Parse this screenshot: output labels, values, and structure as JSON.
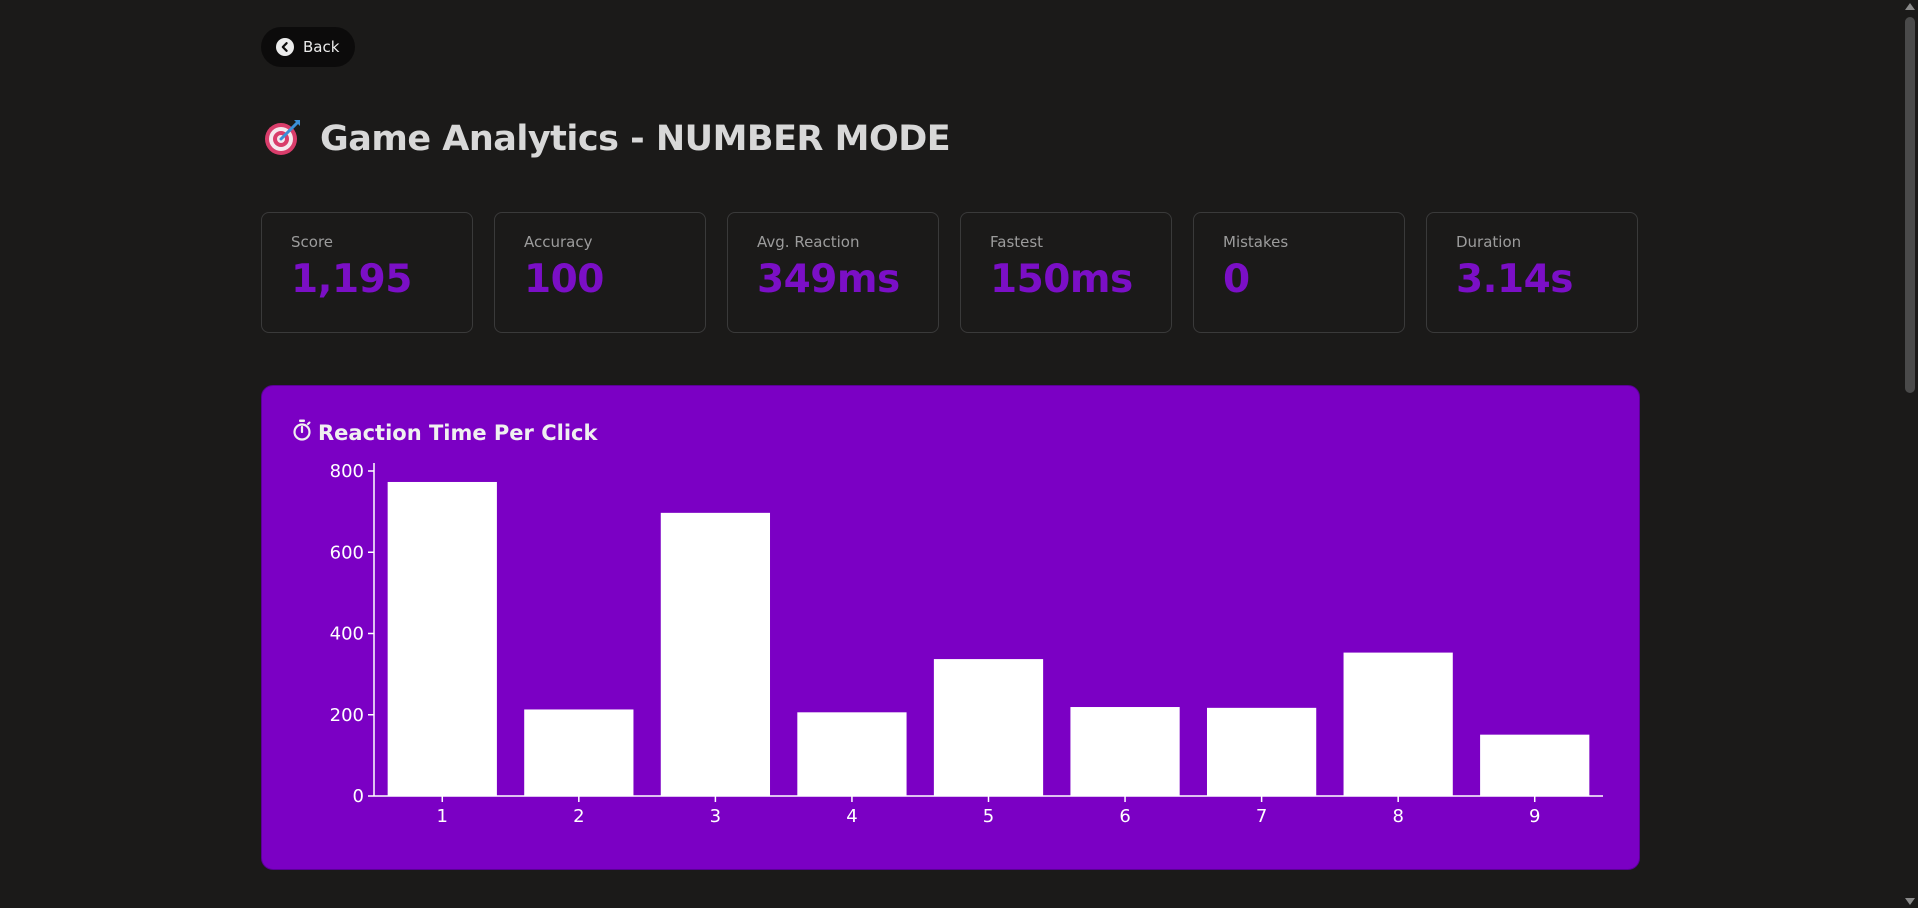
{
  "header": {
    "back_label": "Back",
    "title": "Game Analytics - NUMBER MODE"
  },
  "stats": [
    {
      "label": "Score",
      "value": "1,195"
    },
    {
      "label": "Accuracy",
      "value": "100"
    },
    {
      "label": "Avg. Reaction",
      "value": "349ms"
    },
    {
      "label": "Fastest",
      "value": "150ms"
    },
    {
      "label": "Mistakes",
      "value": "0"
    },
    {
      "label": "Duration",
      "value": "3.14s"
    }
  ],
  "colors": {
    "background": "#1b1a19",
    "accent": "#7b0fc6",
    "chart_panel": "#7b00c4",
    "bar": "#ffffff"
  },
  "chart_data": {
    "type": "bar",
    "title": "Reaction Time Per Click",
    "title_icon": "stopwatch-icon",
    "categories": [
      "1",
      "2",
      "3",
      "4",
      "5",
      "6",
      "7",
      "8",
      "9"
    ],
    "values": [
      773,
      213,
      697,
      206,
      337,
      219,
      217,
      353,
      151
    ],
    "ylim": [
      0,
      800
    ],
    "yticks": [
      0,
      200,
      400,
      600,
      800
    ],
    "xlabel": "",
    "ylabel": "",
    "grid": false,
    "legend": false
  }
}
